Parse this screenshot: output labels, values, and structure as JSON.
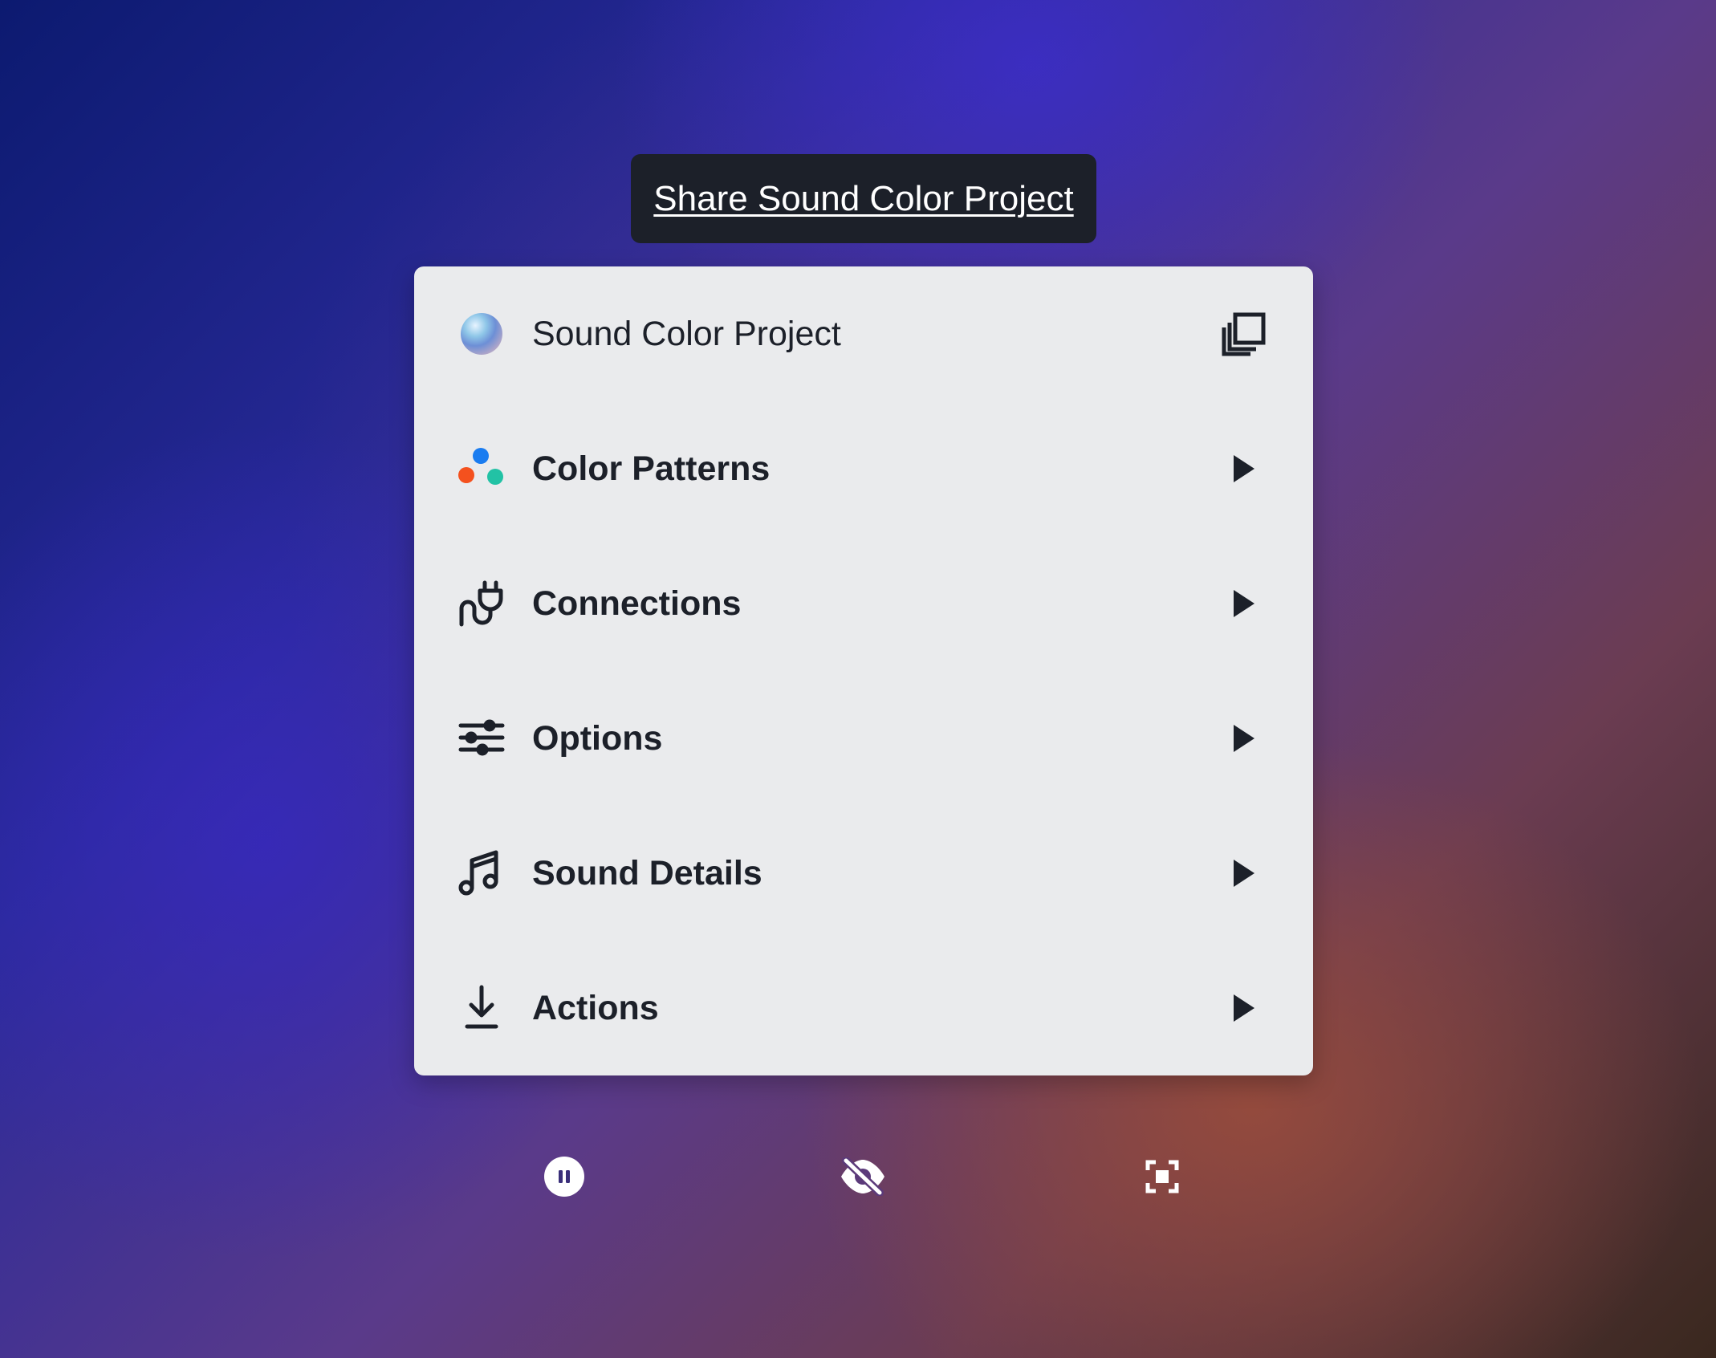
{
  "tooltip": {
    "text": "Share Sound Color Project"
  },
  "menu": {
    "header": {
      "title": "Sound Color Project",
      "icon": "gradient-sphere-icon",
      "action_icon": "copy-icon"
    },
    "items": [
      {
        "label": "Color Patterns",
        "icon": "color-dots-icon",
        "arrow": "play-arrow-icon"
      },
      {
        "label": "Connections",
        "icon": "plug-icon",
        "arrow": "play-arrow-icon"
      },
      {
        "label": "Options",
        "icon": "sliders-icon",
        "arrow": "play-arrow-icon"
      },
      {
        "label": "Sound Details",
        "icon": "music-note-icon",
        "arrow": "play-arrow-icon"
      },
      {
        "label": "Actions",
        "icon": "download-icon",
        "arrow": "play-arrow-icon"
      }
    ]
  },
  "controls": {
    "pause": "pause-icon",
    "hide": "eye-off-icon",
    "focus": "focus-frame-icon"
  },
  "colors": {
    "text_dark": "#1c2029",
    "menu_bg": "#eaebed",
    "dot_blue": "#1a7cf0",
    "dot_orange": "#f4511e",
    "dot_teal": "#22c2a5"
  }
}
